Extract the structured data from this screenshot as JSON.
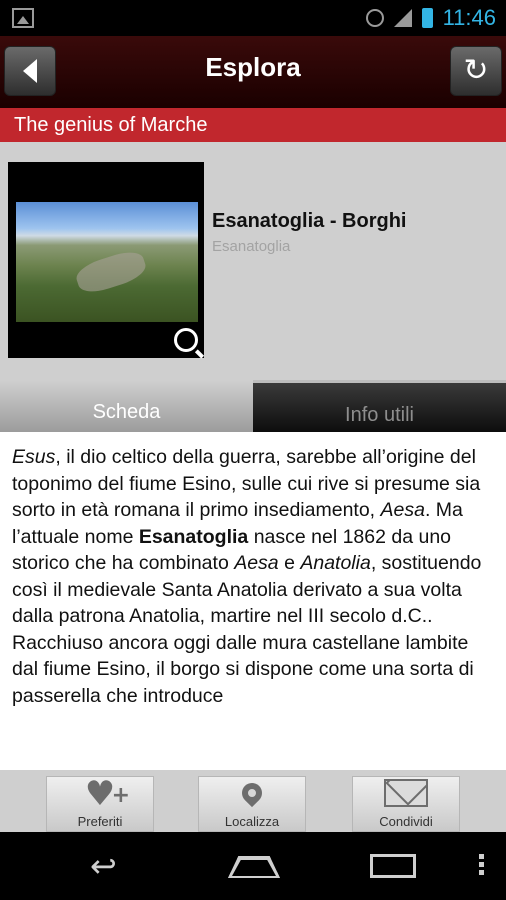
{
  "status_bar": {
    "time": "11:46",
    "icons": [
      "image-icon",
      "alarm-icon",
      "signal-icon",
      "battery-icon"
    ],
    "time_color": "#33b5e5"
  },
  "action_bar": {
    "title": "Esplora",
    "left_button_icon": "back-arrow-icon",
    "right_button_icon": "refresh-icon"
  },
  "category": {
    "label": "The genius of Marche",
    "color": "#c1272d"
  },
  "poi": {
    "title": "Esanatoglia - Borghi",
    "subtitle": "Esanatoglia",
    "thumbnail_icon": "zoom-icon"
  },
  "tabs": [
    {
      "label": "Scheda",
      "active": true
    },
    {
      "label": "Info utili",
      "active": false
    }
  ],
  "content": {
    "text": [
      {
        "t": "Esus",
        "style": "italic"
      },
      {
        "t": ", il dio celtico della guerra, sarebbe all’origine del toponimo del fiume Esino, sulle cui rive si presume sia sorto in età romana il primo insediamento, "
      },
      {
        "t": "Aesa",
        "style": "italic"
      },
      {
        "t": ". Ma l’attuale nome "
      },
      {
        "t": "Esanatoglia",
        "style": "bold"
      },
      {
        "t": " nasce nel 1862 da uno storico che ha combinato "
      },
      {
        "t": "Aesa",
        "style": "italic"
      },
      {
        "t": " e "
      },
      {
        "t": "Anatolia",
        "style": "italic"
      },
      {
        "t": ", sostituendo così il medievale Santa Anatolia derivato a sua volta dalla patrona Anatolia, martire nel III secolo d.C.."
      },
      {
        "t": "\n"
      },
      {
        "t": "Racchiuso ancora oggi dalle mura castellane lambite dal fiume Esino, il borgo si dispone come una sorta di passerella che introduce"
      }
    ]
  },
  "toolbar": {
    "favorites_label": "Preferiti",
    "locate_label": "Localizza",
    "share_label": "Condividi"
  },
  "nav_bar": {
    "icons": [
      "back-icon",
      "home-icon",
      "recent-apps-icon",
      "menu-icon"
    ]
  }
}
